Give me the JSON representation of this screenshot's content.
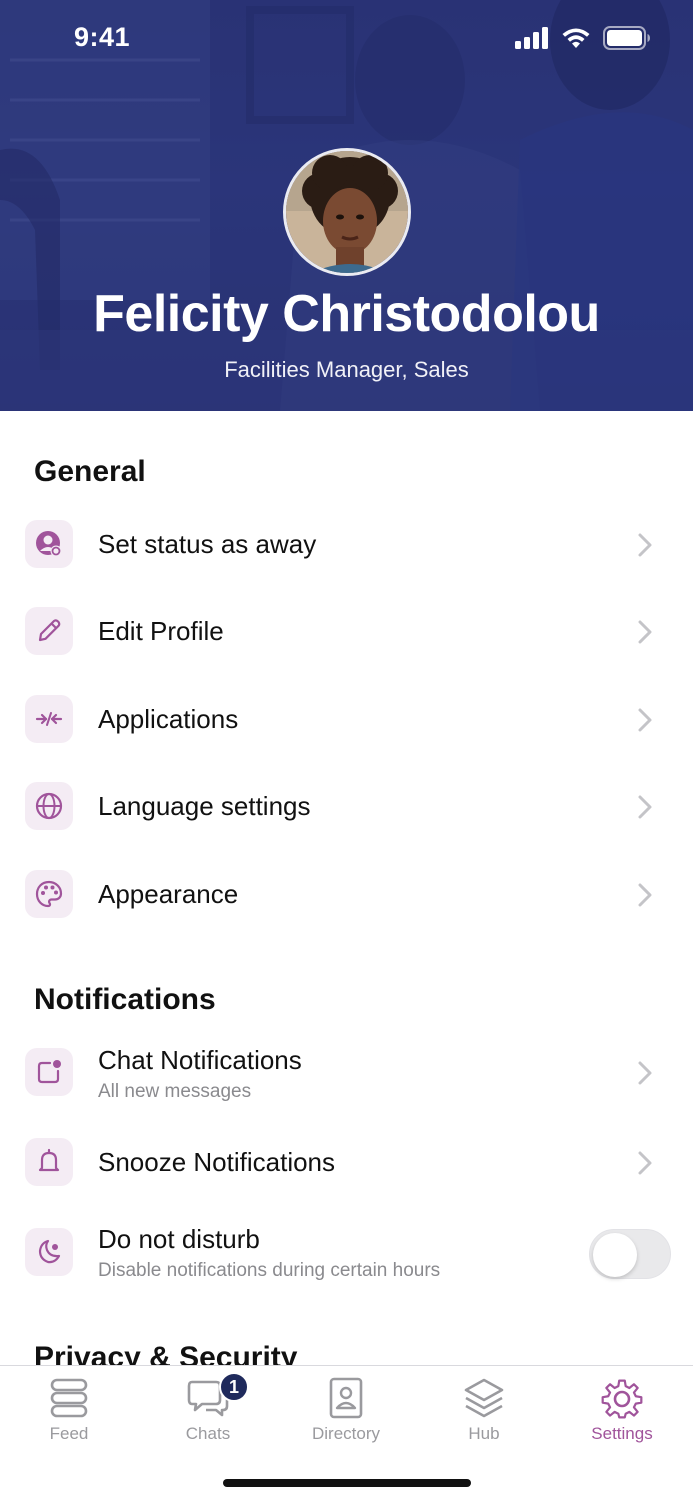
{
  "status_bar": {
    "time": "9:41"
  },
  "profile": {
    "name": "Felicity Christodolou",
    "role": "Facilities Manager, Sales"
  },
  "general": {
    "title": "General",
    "items": [
      {
        "label": "Set status as away",
        "icon": "user-status-icon"
      },
      {
        "label": "Edit Profile",
        "icon": "pencil-icon"
      },
      {
        "label": "Applications",
        "icon": "applications-icon"
      },
      {
        "label": "Language settings",
        "icon": "globe-icon"
      },
      {
        "label": "Appearance",
        "icon": "palette-icon"
      }
    ]
  },
  "notifications": {
    "title": "Notifications",
    "items": [
      {
        "label": "Chat Notifications",
        "subtitle": "All new messages",
        "icon": "chat-notification-icon"
      },
      {
        "label": "Snooze Notifications",
        "icon": "bell-icon"
      },
      {
        "label": "Do not disturb",
        "subtitle": "Disable notifications during certain hours",
        "icon": "moon-icon",
        "toggle": false
      }
    ]
  },
  "privacy": {
    "title": "Privacy & Security"
  },
  "tabbar": {
    "tabs": [
      {
        "label": "Feed",
        "icon": "feed-icon"
      },
      {
        "label": "Chats",
        "icon": "chats-icon",
        "badge": "1"
      },
      {
        "label": "Directory",
        "icon": "directory-icon"
      },
      {
        "label": "Hub",
        "icon": "hub-icon"
      },
      {
        "label": "Settings",
        "icon": "settings-icon",
        "active": true
      }
    ]
  },
  "colors": {
    "accent": "#a0549b",
    "header": "#2e3a7c",
    "icon_bg": "#f4ecf4",
    "badge": "#1f2a5c"
  }
}
